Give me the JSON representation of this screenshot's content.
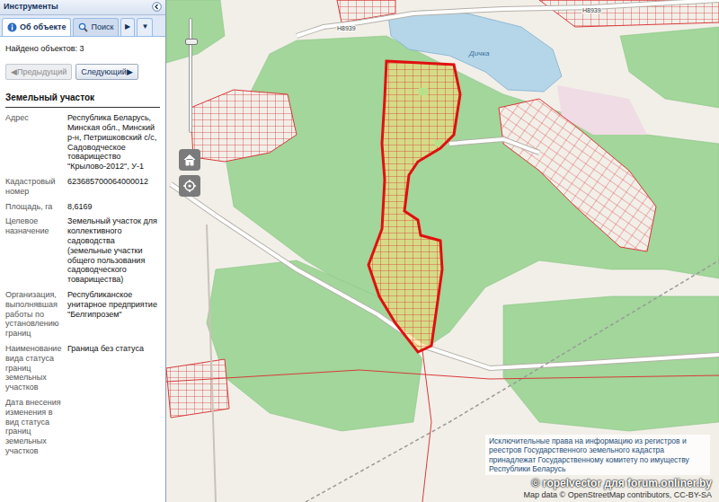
{
  "panel": {
    "title": "Инструменты",
    "tabs": [
      {
        "label": "Об объекте",
        "selected": true
      },
      {
        "label": "Поиск",
        "selected": false
      }
    ],
    "tab_scroll": "▶",
    "tab_menu": "▼"
  },
  "results": {
    "found": "Найдено объектов: 3",
    "prev": {
      "label": "◀Предыдущий",
      "disabled": true
    },
    "next": {
      "label": "Следующий▶",
      "disabled": false
    }
  },
  "object": {
    "title": "Земельный участок",
    "fields": [
      {
        "label": "Адрес",
        "value": "Республика Беларусь, Минская обл., Минский р-н, Петришковский с/с, Садоводческое товарищество \"Крылово-2012\", У-1"
      },
      {
        "label": "Кадастровый номер",
        "value": "623685700064000012"
      },
      {
        "label": "Площадь, га",
        "value": "8,6169"
      },
      {
        "label": "Целевое назначение",
        "value": "Земельный участок для коллективного садоводства (земельные участки общего пользования садоводческого товарищества)"
      },
      {
        "label": "Организация, выполнявшая работы по установлению границ",
        "value": "Республиканское унитарное предприятие \"Белгипрозем\""
      },
      {
        "label": "Наименование вида статуса границ земельных участков",
        "value": "Граница без статуса"
      },
      {
        "label": "Дата внесения изменения в вид статуса границ земельных участков",
        "value": ""
      }
    ]
  },
  "map": {
    "zoom": {
      "level": 0.82
    },
    "labels": [
      {
        "text": "Н8939"
      },
      {
        "text": "Н8939"
      },
      {
        "text": "Дичка"
      }
    ],
    "notice": "Исключительные права на информацию из регистров и реестров Государственного земельного кадастра принадлежат Государственному комитету по имуществу Республики Беларусь",
    "watermark": "© ropelvector для forum.onliner.by",
    "attribution": "Map data © OpenStreetMap contributors, CC-BY-SA"
  }
}
